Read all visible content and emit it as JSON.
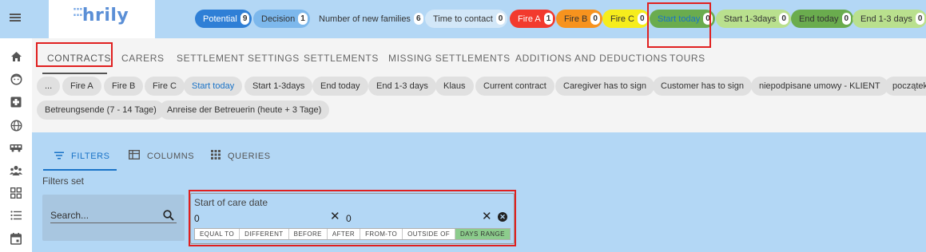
{
  "brand": {
    "name": "hrily"
  },
  "status_chips": [
    {
      "label": "Potential",
      "count": "9",
      "bg": "#2f7fd6",
      "fg": "#ffffff"
    },
    {
      "label": "Decision",
      "count": "1",
      "bg": "#7db8ec",
      "fg": "#333333"
    },
    {
      "label": "Number of new families",
      "count": "6",
      "bg": "#b3d7f5",
      "fg": "#333333"
    },
    {
      "label": "Time to contact",
      "count": "0",
      "bg": "#d2e7f8",
      "fg": "#333333"
    },
    {
      "label": "Fire A",
      "count": "1",
      "bg": "#f23a2e",
      "fg": "#ffffff"
    },
    {
      "label": "Fire B",
      "count": "0",
      "bg": "#f7931e",
      "fg": "#333333"
    },
    {
      "label": "Fire C",
      "count": "0",
      "bg": "#f6ed1c",
      "fg": "#333333"
    },
    {
      "label": "Start today",
      "count": "0",
      "bg": "#6aac4e",
      "fg": "#1a73c7"
    },
    {
      "label": "Start 1-3days",
      "count": "0",
      "bg": "#b9e08e",
      "fg": "#333333"
    },
    {
      "label": "End today",
      "count": "0",
      "bg": "#6aac4e",
      "fg": "#333333"
    },
    {
      "label": "End 1-3 days",
      "count": "0",
      "bg": "#b9e08e",
      "fg": "#333333"
    }
  ],
  "sidebar_icons": [
    "home-icon",
    "face-icon",
    "medical-cross-icon",
    "globe-icon",
    "bus-icon",
    "people-icon",
    "dashboard-grid-icon",
    "list-icon",
    "calendar-icon"
  ],
  "tabs": [
    "CONTRACTS",
    "CARERS",
    "SETTLEMENT SETTINGS",
    "SETTLEMENTS",
    "MISSING SETTLEMENTS",
    "ADDITIONS AND DEDUCTIONS",
    "TOURS"
  ],
  "quick_filters_row1": [
    "...",
    "Fire A",
    "Fire B",
    "Fire C",
    "Start today",
    "Start 1-3days",
    "End today",
    "End 1-3 days",
    "Klaus",
    "Current contract",
    "Caregiver has to sign",
    "Customer has to sign",
    "niepodpisane umowy - KLIENT",
    "początek"
  ],
  "quick_filters_row2": [
    "Betreungsende (7 - 14 Tage)",
    "Anreise der Betreuerin (heute + 3 Tage)"
  ],
  "panel": {
    "tabs": [
      "FILTERS",
      "COLUMNS",
      "QUERIES"
    ],
    "filters_set_label": "Filters set",
    "search": {
      "placeholder": "Search...",
      "value": ""
    },
    "date_filter": {
      "title": "Start of care date",
      "from": "0",
      "to": "0",
      "modes": [
        "EQUAL TO",
        "DIFFERENT",
        "BEFORE",
        "AFTER",
        "FROM-TO",
        "OUTSIDE OF",
        "DAYS RANGE"
      ],
      "selected_mode": "DAYS RANGE"
    }
  }
}
